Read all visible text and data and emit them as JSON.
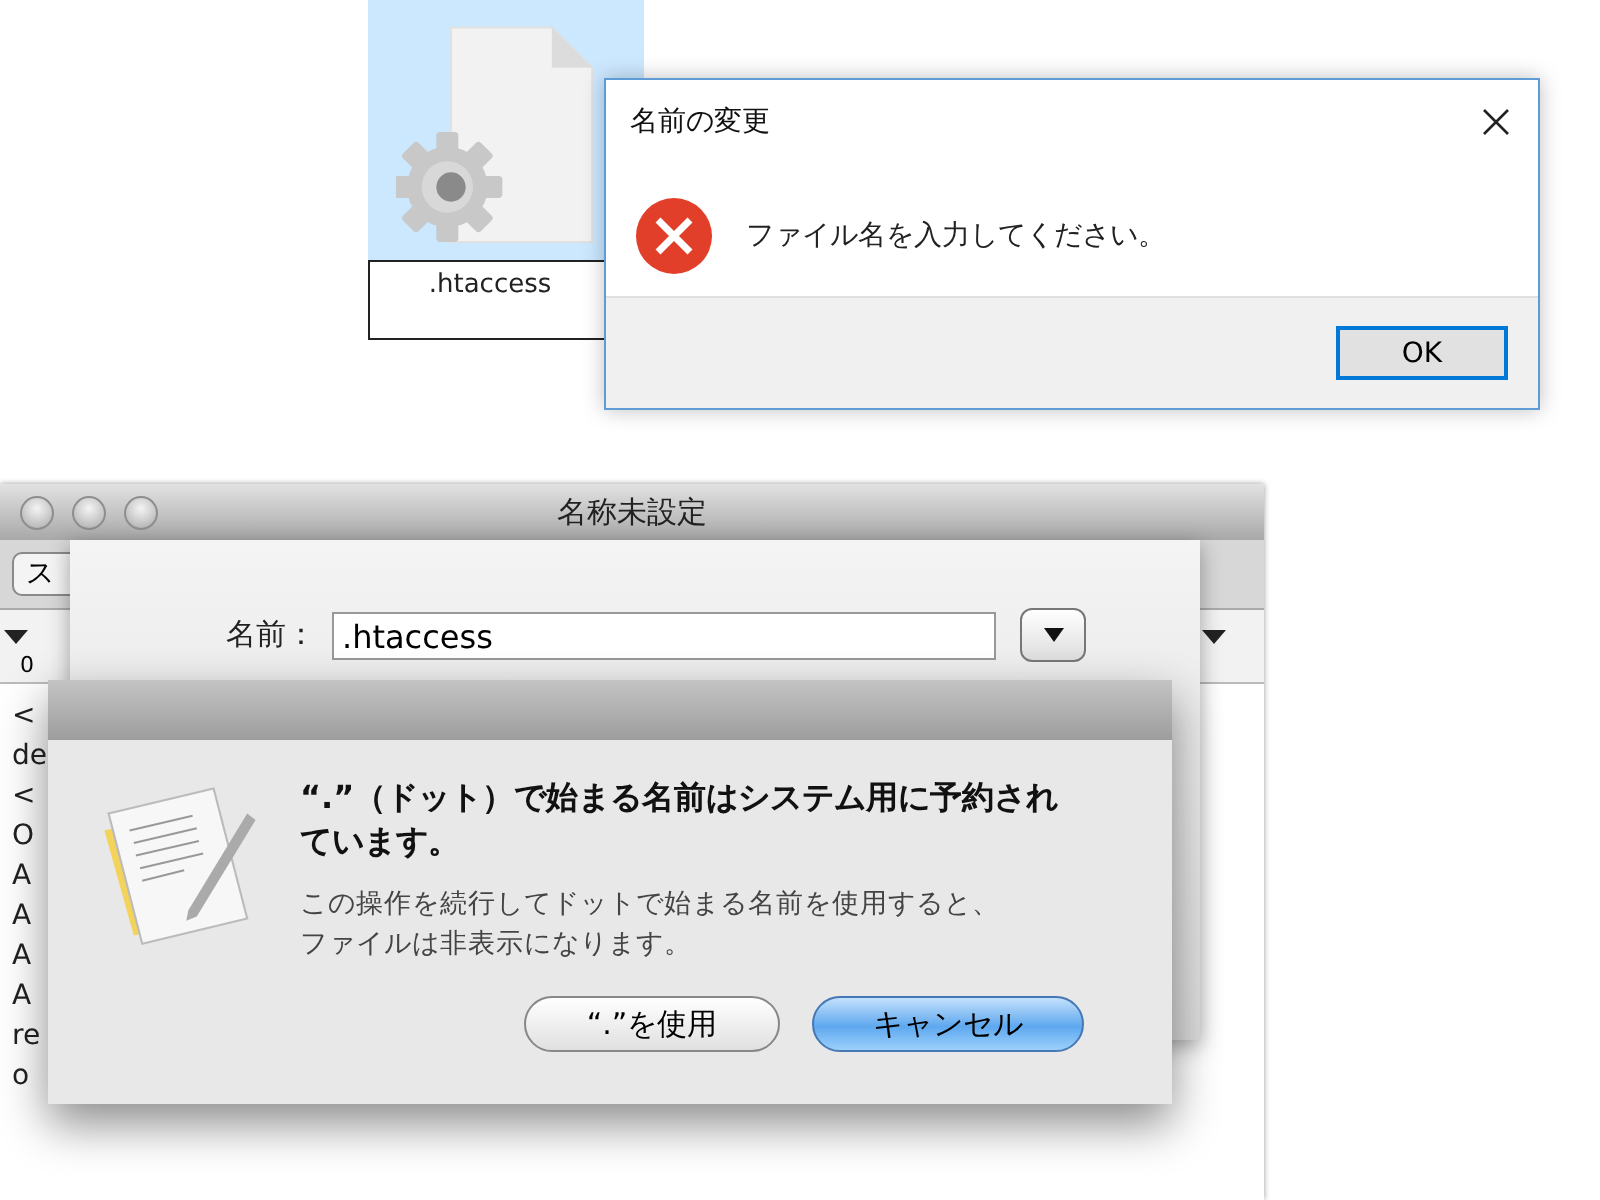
{
  "file_icon": {
    "label": ".htaccess",
    "selected": true
  },
  "rename_dialog": {
    "title": "名前の変更",
    "message": "ファイル名を入力してください。",
    "buttons": [
      {
        "label": "OK",
        "default": true
      }
    ]
  },
  "mac_window": {
    "title": "名称未設定",
    "toolbar_fragment": "ス",
    "ruler_label": "0",
    "document_lines": [
      "<",
      "de",
      "<",
      "O",
      "A",
      "A",
      "A",
      "A",
      "re",
      "o"
    ],
    "save_sheet": {
      "name_label": "名前：",
      "name_value": ".htaccess"
    },
    "alert": {
      "heading": "“.”（ドット）で始まる名前はシステム用に予約されています。",
      "message": "この操作を続行してドットで始まる名前を使用すると、ファイルは非表示になります。",
      "buttons": [
        {
          "label": "“.”を使用",
          "default": false
        },
        {
          "label": "キャンセル",
          "default": true
        }
      ]
    }
  }
}
